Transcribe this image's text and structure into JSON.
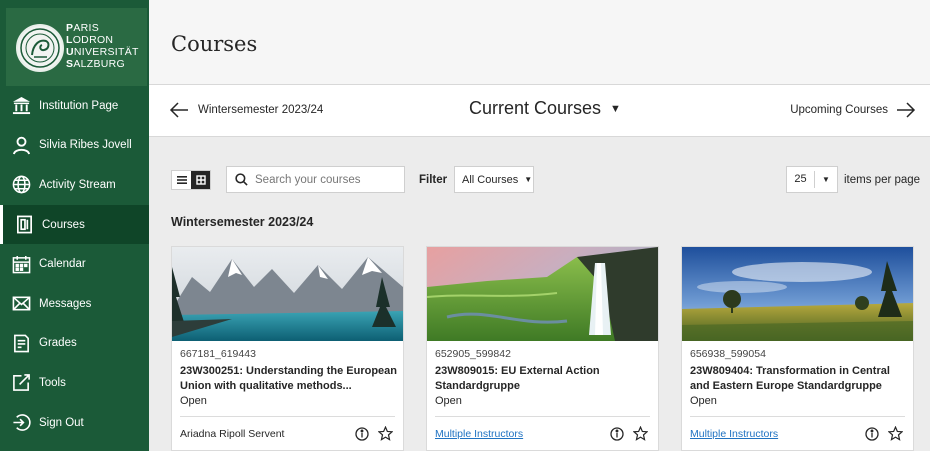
{
  "branding": {
    "logo_lines": [
      {
        "initial": "P",
        "rest": "ARIS"
      },
      {
        "initial": "L",
        "rest": "ODRON"
      },
      {
        "initial": "U",
        "rest": "NIVERSITÄT"
      },
      {
        "initial": "S",
        "rest": "ALZBURG"
      }
    ],
    "sidebar_color": "#1b5a38",
    "active_color": "#0f4528"
  },
  "nav": {
    "items": [
      {
        "label": "Institution Page",
        "icon": "institution-icon"
      },
      {
        "label": "Silvia Ribes Jovell",
        "icon": "user-icon"
      },
      {
        "label": "Activity Stream",
        "icon": "globe-icon"
      },
      {
        "label": "Courses",
        "icon": "courses-icon",
        "active": true
      },
      {
        "label": "Calendar",
        "icon": "calendar-icon"
      },
      {
        "label": "Messages",
        "icon": "envelope-icon"
      },
      {
        "label": "Grades",
        "icon": "grades-icon"
      },
      {
        "label": "Tools",
        "icon": "tools-icon"
      },
      {
        "label": "Sign Out",
        "icon": "sign-out-icon"
      }
    ]
  },
  "header": {
    "title": "Courses"
  },
  "term_nav": {
    "previous": "Wintersemester 2023/24",
    "current": "Current Courses",
    "next": "Upcoming Courses"
  },
  "toolbar": {
    "search_placeholder": "Search your courses",
    "filter_label": "Filter",
    "filter_value": "All Courses",
    "per_page_value": "25",
    "per_page_label": "items per page"
  },
  "section": {
    "title": "Wintersemester 2023/24"
  },
  "courses": [
    {
      "code": "667181_619443",
      "name": "23W300251: Understanding the European Union with qualitative methods...",
      "status": "Open",
      "instructor": "Ariadna Ripoll Servent",
      "instructor_is_link": false,
      "image": "mountain-lake"
    },
    {
      "code": "652905_599842",
      "name": "23W809015: EU External Action Standardgruppe",
      "status": "Open",
      "instructor": "Multiple Instructors",
      "instructor_is_link": true,
      "image": "waterfall"
    },
    {
      "code": "656938_599054",
      "name": "23W809404: Transformation in Central and Eastern Europe Standardgruppe",
      "status": "Open",
      "instructor": "Multiple Instructors",
      "instructor_is_link": true,
      "image": "countryside-field"
    }
  ]
}
